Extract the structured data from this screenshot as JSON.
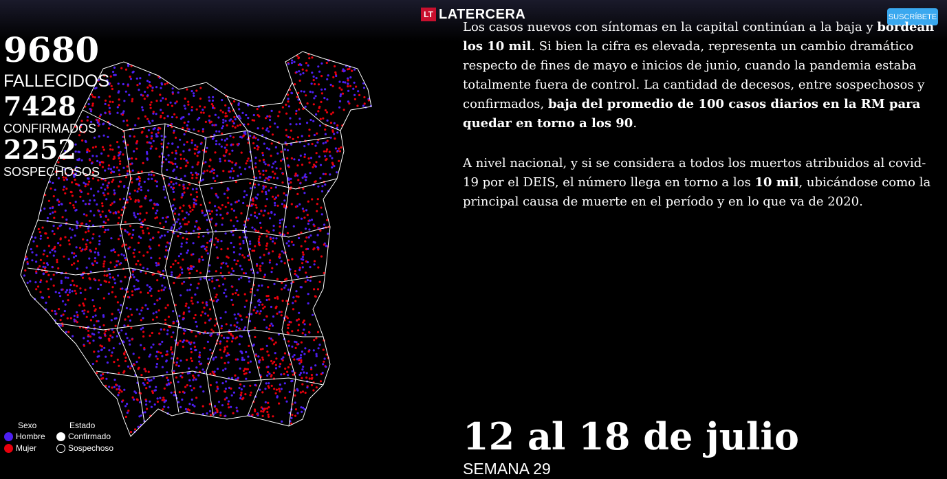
{
  "header": {
    "logo_mark": "LT",
    "logo_text": "LATERCERA",
    "subscribe_label": "SUSCRÍBETE"
  },
  "stats": {
    "deaths_value": "9680",
    "deaths_label": "FALLECIDOS",
    "confirmed_value": "7428",
    "confirmed_label": "CONFIRMADOS",
    "suspected_value": "2252",
    "suspected_label": "SOSPECHOSOS"
  },
  "legend": {
    "sex_title": "Sexo",
    "male_label": "Hombre",
    "female_label": "Mujer",
    "status_title": "Estado",
    "confirmed_label": "Confirmado",
    "suspected_label": "Sospechoso"
  },
  "colors": {
    "male": "#4d1ff2",
    "female": "#e8000c",
    "subscribe": "#3aa8ef",
    "logo": "#c8102e"
  },
  "article": {
    "p1_a": "Los casos nuevos con síntomas en la capital continúan a la baja y ",
    "p1_b": "bordean los 10 mil",
    "p1_c": ". Si bien la cifra es elevada, representa un cambio dramático respecto de fines de mayo e inicios de junio, cuando la pandemia estaba totalmente fuera de control. La cantidad de decesos, entre sospechosos y confirmados, ",
    "p1_d": "baja del promedio de 100 casos diarios en la RM para quedar en torno a los 90",
    "p1_e": ".",
    "p2_a": "A nivel nacional, y si se considera a todos los muertos atribuidos al covid-19 por el DEIS, el número llega en torno a los ",
    "p2_b": "10 mil",
    "p2_c": ", ubicándose como la principal causa de muerte en el período y en lo que va de 2020."
  },
  "period": {
    "date_range": "12 al 18 de julio",
    "week_label": "SEMANA 29"
  }
}
